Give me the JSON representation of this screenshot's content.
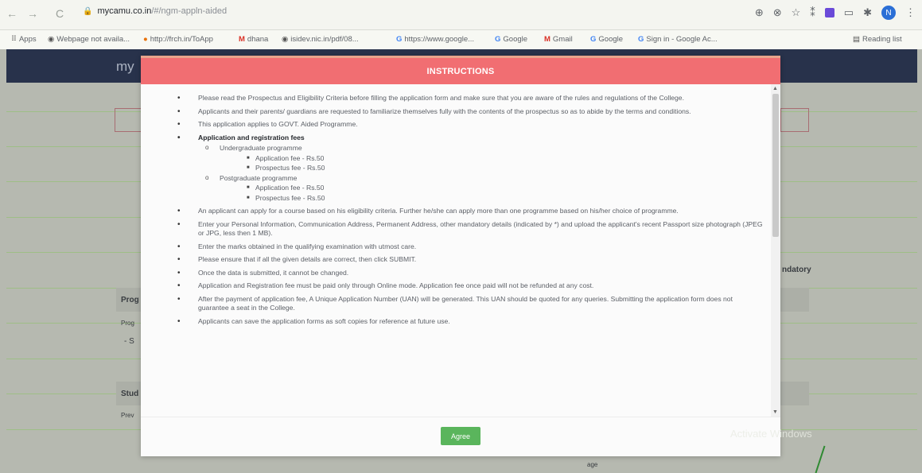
{
  "browser": {
    "url_host": "mycamu.co.in",
    "url_path": "/#/ngm-appln-aided",
    "avatar_letter": "N"
  },
  "bookmarks": [
    {
      "label": "Apps",
      "icon": "apps-icon"
    },
    {
      "label": "Webpage not availa...",
      "icon": "globe-icon"
    },
    {
      "label": "http://frch.in/ToApp",
      "icon": "bookmark-icon"
    },
    {
      "label": "dhana",
      "icon": "gmail-icon"
    },
    {
      "label": "isidev.nic.in/pdf/08...",
      "icon": "globe-icon"
    },
    {
      "label": "https://www.google...",
      "icon": "google-icon"
    },
    {
      "label": "Google",
      "icon": "google-icon"
    },
    {
      "label": "Gmail",
      "icon": "gmail-icon"
    },
    {
      "label": "Google",
      "icon": "google-icon"
    },
    {
      "label": "Sign in - Google Ac...",
      "icon": "google-icon"
    }
  ],
  "reading_list": "Reading list",
  "page": {
    "brand": "my",
    "bg_labels": [
      "Prog",
      "Prog",
      "- S",
      "Stud",
      "Prev",
      "ndatory",
      "age"
    ]
  },
  "modal": {
    "title": "INSTRUCTIONS",
    "items": [
      "Please read the Prospectus and Eligibility Criteria before filling the application form and make sure that you are aware of the rules and regulations of the College.",
      "Applicants and their parents/ guardians are requested to familiarize themselves fully with the contents of the prospectus so as to abide by the terms and conditions.",
      "This application applies to GOVT. Aided Programme.",
      "An applicant can apply for a course based on his eligibility criteria. Further he/she can apply more than one programme based on his/her choice of programme.",
      "Enter your Personal Information, Communication Address, Permanent Address, other mandatory details (indicated by *) and upload the applicant's recent Passport size photograph (JPEG or JPG, less then 1 MB).",
      "Enter the marks obtained in the qualifying examination with utmost care.",
      "Please ensure that if all the given details are correct, then click SUBMIT.",
      "Once the data is submitted, it cannot be changed.",
      "Application and Registration fee must be paid only through Online mode. Application fee once paid will not be refunded at any cost.",
      "After the payment of application fee, A Unique Application Number (UAN) will be generated. This UAN should be quoted for any queries. Submitting the application form does not guarantee a seat in the College.",
      "Applicants can save the application forms as soft copies for reference at future use."
    ],
    "fees": {
      "heading": "Application and registration fees",
      "ug": {
        "label": "Undergraduate programme",
        "application_fee": "Application fee - Rs.50",
        "prospectus_fee": "Prospectus fee - Rs.50"
      },
      "pg": {
        "label": "Postgraduate programme",
        "application_fee": "Application fee - Rs.50",
        "prospectus_fee": "Prospectus fee - Rs.50"
      }
    },
    "agree_label": "Agree"
  },
  "watermark": "Activate Windows"
}
